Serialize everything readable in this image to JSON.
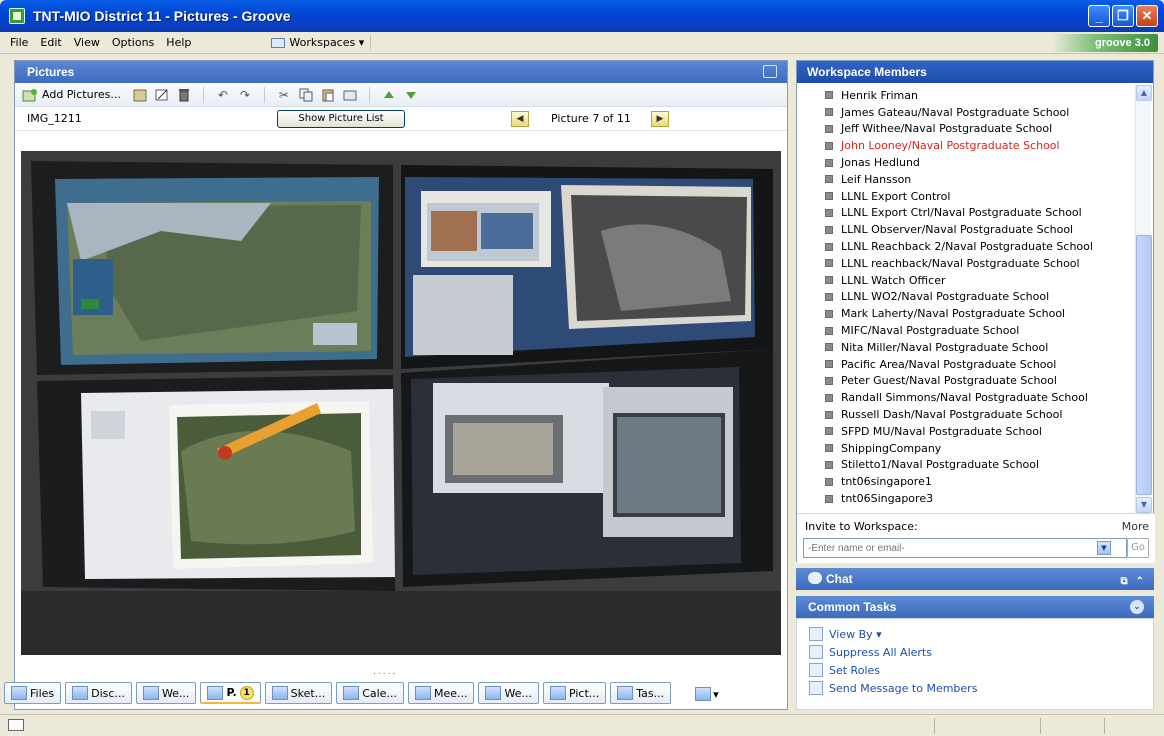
{
  "window": {
    "title": "TNT-MIO District 11 - Pictures - Groove",
    "controls": [
      "_",
      "❐",
      "✕"
    ]
  },
  "menu": {
    "items": [
      "File",
      "Edit",
      "View",
      "Options",
      "Help"
    ],
    "workspaces_label": "Workspaces ▾",
    "logo_text": "groove 3.0"
  },
  "pictures": {
    "header": "Pictures",
    "add_pictures_label": "Add Pictures...",
    "picture_name": "IMG_1211",
    "show_list_label": "Show Picture List",
    "counter": "Picture 7 of 11",
    "prev_glyph": "◀",
    "next_glyph": "▶",
    "dots": "....."
  },
  "tabs": [
    {
      "label": "Files"
    },
    {
      "label": "Disc..."
    },
    {
      "label": "We..."
    },
    {
      "label": "P.",
      "badge": "1",
      "active": true
    },
    {
      "label": "Sket..."
    },
    {
      "label": "Cale..."
    },
    {
      "label": "Mee..."
    },
    {
      "label": "We..."
    },
    {
      "label": "Pict..."
    },
    {
      "label": "Tas..."
    }
  ],
  "members": {
    "header": "Workspace Members",
    "list": [
      "Henrik Friman",
      "James Gateau/Naval Postgraduate School",
      "Jeff Withee/Naval Postgraduate School",
      "John Looney/Naval Postgraduate School",
      "Jonas Hedlund",
      "Leif Hansson",
      "LLNL Export Control",
      "LLNL Export Ctrl/Naval Postgraduate School",
      "LLNL Observer/Naval Postgraduate School",
      "LLNL Reachback 2/Naval Postgraduate School",
      "LLNL reachback/Naval Postgraduate School",
      "LLNL Watch Officer",
      "LLNL WO2/Naval Postgraduate School",
      "Mark Laherty/Naval Postgraduate School",
      "MIFC/Naval Postgraduate School",
      "Nita Miller/Naval Postgraduate School",
      "Pacific Area/Naval Postgraduate School",
      "Peter Guest/Naval Postgraduate School",
      "Randall Simmons/Naval Postgraduate School",
      "Russell Dash/Naval Postgraduate School",
      "SFPD MU/Naval Postgraduate School",
      "ShippingCompany",
      "Stiletto1/Naval Postgraduate School",
      "tnt06singapore1",
      "tnt06Singapore3"
    ],
    "highlight_index": 3,
    "highlight_color": "#e0201c"
  },
  "invite": {
    "label": "Invite to Workspace:",
    "more": "More",
    "placeholder": "-Enter name or email-",
    "go": "Go"
  },
  "chat": {
    "label": "Chat"
  },
  "common_tasks": {
    "header": "Common Tasks",
    "items": [
      "View By ▾",
      "Suppress All Alerts",
      "Set Roles",
      "Send Message to Members"
    ]
  }
}
